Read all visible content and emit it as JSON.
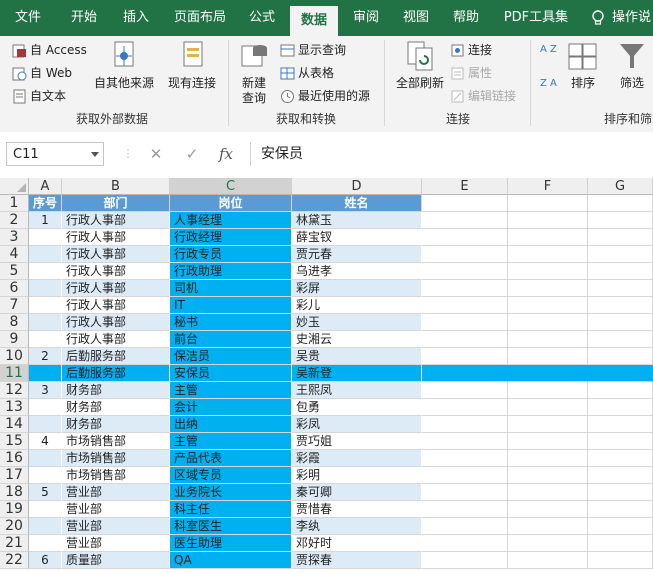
{
  "tabs": [
    "文件",
    "开始",
    "插入",
    "页面布局",
    "公式",
    "数据",
    "审阅",
    "视图",
    "帮助",
    "PDF工具集",
    "操作说"
  ],
  "active_tab": "数据",
  "ribbon": {
    "get_external": {
      "label": "获取外部数据",
      "access": "自 Access",
      "web": "自 Web",
      "text": "自文本",
      "other_sources": "自其他来源",
      "existing": "现有连接"
    },
    "get_transform": {
      "label": "获取和转换",
      "new_query_1": "新建",
      "new_query_2": "查询",
      "show_queries": "显示查询",
      "from_table": "从表格",
      "recent_sources": "最近使用的源"
    },
    "connections": {
      "label": "连接",
      "refresh_all": "全部刷新",
      "connections": "连接",
      "properties": "属性",
      "edit_links": "编辑链接"
    },
    "sort_filter": {
      "label": "排序和筛",
      "sort": "排序",
      "filter": "筛选",
      "az": "A Z",
      "za": "Z A"
    }
  },
  "formula_bar": {
    "name_box": "C11",
    "fx": "fx",
    "content": "安保员"
  },
  "columns": [
    "A",
    "B",
    "C",
    "D",
    "E",
    "F",
    "G"
  ],
  "header_row": [
    "序号",
    "部门",
    "岗位",
    "姓名"
  ],
  "rows": [
    [
      "1",
      "行政人事部",
      "人事经理",
      "林黛玉"
    ],
    [
      "",
      "行政人事部",
      "行政经理",
      "薛宝钗"
    ],
    [
      "",
      "行政人事部",
      "行政专员",
      "贾元春"
    ],
    [
      "",
      "行政人事部",
      "行政助理",
      "乌进孝"
    ],
    [
      "",
      "行政人事部",
      "司机",
      "彩屏"
    ],
    [
      "",
      "行政人事部",
      "IT",
      "彩儿"
    ],
    [
      "",
      "行政人事部",
      "秘书",
      "妙玉"
    ],
    [
      "",
      "行政人事部",
      "前台",
      "史湘云"
    ],
    [
      "2",
      "后勤服务部",
      "保洁员",
      "吴贵"
    ],
    [
      "",
      "后勤服务部",
      "安保员",
      "吴新登"
    ],
    [
      "3",
      "财务部",
      "主管",
      "王熙凤"
    ],
    [
      "",
      "财务部",
      "会计",
      "包勇"
    ],
    [
      "",
      "财务部",
      "出纳",
      "彩凤"
    ],
    [
      "4",
      "市场销售部",
      "主管",
      "贾巧姐"
    ],
    [
      "",
      "市场销售部",
      "产品代表",
      "彩霞"
    ],
    [
      "",
      "市场销售部",
      "区域专员",
      "彩明"
    ],
    [
      "5",
      "营业部",
      "业务院长",
      "秦可卿"
    ],
    [
      "",
      "营业部",
      "科主任",
      "贾惜春"
    ],
    [
      "",
      "营业部",
      "科室医生",
      "李纨"
    ],
    [
      "",
      "营业部",
      "医生助理",
      "邓好时"
    ],
    [
      "6",
      "质量部",
      "QA",
      "贾探春"
    ]
  ],
  "colors": {
    "excel_green": "#217346",
    "header_blue": "#5b9bd5",
    "band_light": "#ddebf7",
    "post_column": "#00b0f0",
    "selected_row": "#00b0f0"
  }
}
